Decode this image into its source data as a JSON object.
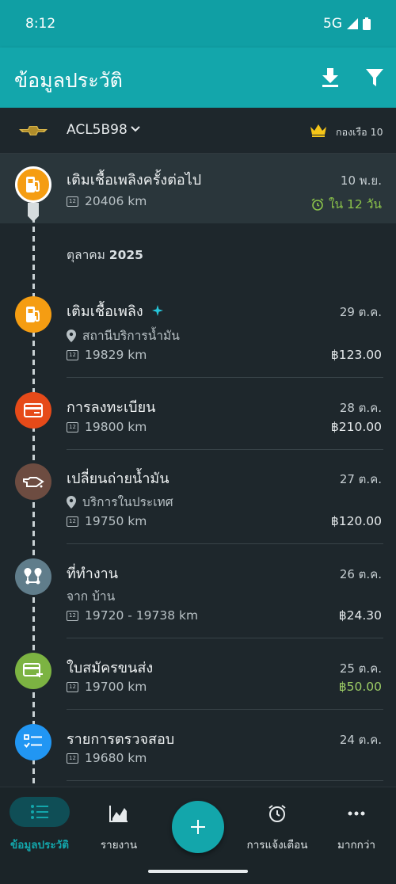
{
  "status_bar": {
    "time": "8:12",
    "network": "5G"
  },
  "app_bar": {
    "title": "ข้อมูลประวัติ",
    "download_icon": "download-icon",
    "filter_icon": "filter-icon"
  },
  "vehicle": {
    "plate": "ACL5B98",
    "fleet_label": "กองเรือ 10"
  },
  "next_refuel": {
    "title": "เติมเชื้อเพลิงครั้งต่อไป",
    "date": "10 พ.ย.",
    "odometer": "20406 km",
    "due": "ใน 12 วัน"
  },
  "month": {
    "prefix": "ตุลาคม",
    "year": "2025"
  },
  "entries": [
    {
      "title": "เติมเชื้อเพลิง",
      "date": "29 ต.ค.",
      "location": "สถานีบริการน้ำมัน",
      "odometer": "19829 km",
      "cost": "฿123.00",
      "icon": "fuel-pump-icon",
      "color": "#f59d12"
    },
    {
      "title": "การลงทะเบียน",
      "date": "28 ต.ค.",
      "odometer": "19800 km",
      "cost": "฿210.00",
      "icon": "credit-card-minus-icon",
      "color": "#e64a19"
    },
    {
      "title": "เปลี่ยนถ่ายน้ำมัน",
      "date": "27 ต.ค.",
      "location": "บริการในประเทศ",
      "odometer": "19750 km",
      "cost": "฿120.00",
      "icon": "oil-can-icon",
      "color": "#6d4c41"
    },
    {
      "title": "ที่ทำงาน",
      "date": "26 ต.ค.",
      "route": "จาก บ้าน",
      "odometer": "19720 - 19738 km",
      "cost": "฿24.30",
      "icon": "route-pins-icon",
      "color": "#607d8b"
    },
    {
      "title": "ใบสมัครขนส่ง",
      "date": "25 ต.ค.",
      "odometer": "19700 km",
      "cost": "฿50.00",
      "cost_color": "#9ccc65",
      "icon": "credit-card-plus-icon",
      "color": "#7cb342"
    },
    {
      "title": "รายการตรวจสอบ",
      "date": "24 ต.ค.",
      "odometer": "19680 km",
      "icon": "checklist-icon",
      "color": "#2196f3"
    }
  ],
  "bottom_nav": [
    {
      "label": "ข้อมูลประวัติ",
      "icon": "history-list-icon",
      "active": true
    },
    {
      "label": "รายงาน",
      "icon": "chart-icon"
    },
    {
      "label": "",
      "icon": "add-icon"
    },
    {
      "label": "การแจ้งเตือน",
      "icon": "alarm-icon"
    },
    {
      "label": "มากกว่า",
      "icon": "more-dots-icon"
    }
  ],
  "colors": {
    "accent": "#13a6ab",
    "background": "#1e272c",
    "due_green": "#8bc34a",
    "crown_gold": "#f5c518"
  }
}
